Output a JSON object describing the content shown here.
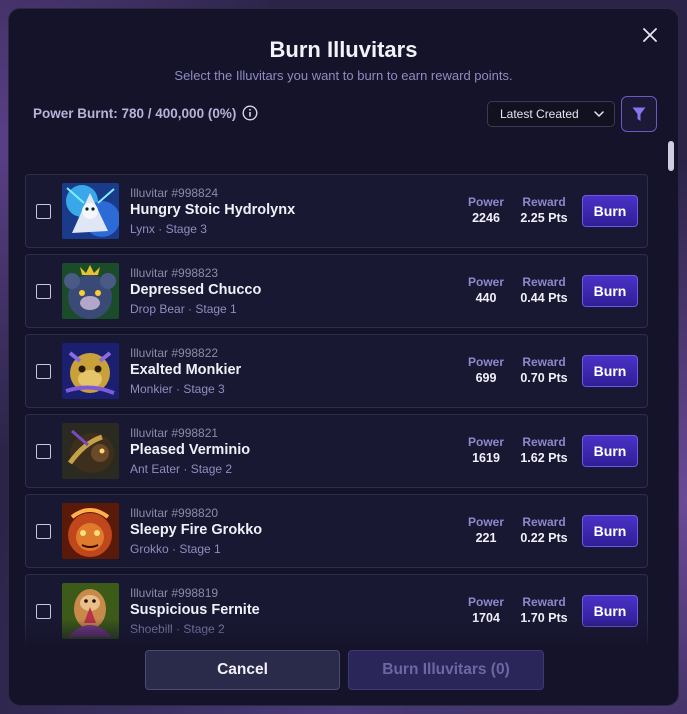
{
  "modal": {
    "title": "Burn Illuvitars",
    "subtitle": "Select the Illuvitars you want to burn to earn reward points.",
    "power_burnt": "Power Burnt: 780 / 400,000 (0%)",
    "sort": {
      "selected": "Latest Created"
    },
    "power_label": "Power",
    "reward_label": "Reward",
    "burn_label": "Burn",
    "cancel_label": "Cancel",
    "burn_all_label": "Burn Illuvitars (0)",
    "accent_color": "#3a26b0"
  },
  "items": [
    {
      "id": "Illuvitar #998824",
      "name": "Hungry Stoic Hydrolynx",
      "meta": "Lynx · Stage 3",
      "power": "2246",
      "reward": "2.25 Pts",
      "image": "blue-lynx-creature"
    },
    {
      "id": "Illuvitar #998823",
      "name": "Depressed Chucco",
      "meta": "Drop Bear · Stage 1",
      "power": "440",
      "reward": "0.44 Pts",
      "image": "green-drop-bear"
    },
    {
      "id": "Illuvitar #998822",
      "name": "Exalted Monkier",
      "meta": "Monkier · Stage 3",
      "power": "699",
      "reward": "0.70 Pts",
      "image": "golden-monkey"
    },
    {
      "id": "Illuvitar #998821",
      "name": "Pleased Verminio",
      "meta": "Ant Eater · Stage 2",
      "power": "1619",
      "reward": "1.62 Pts",
      "image": "dark-ant-eater"
    },
    {
      "id": "Illuvitar #998820",
      "name": "Sleepy Fire Grokko",
      "meta": "Grokko · Stage 1",
      "power": "221",
      "reward": "0.22 Pts",
      "image": "fire-grokko"
    },
    {
      "id": "Illuvitar #998819",
      "name": "Suspicious Fernite",
      "meta": "Shoebill · Stage 2",
      "power": "1704",
      "reward": "1.70 Pts",
      "image": "green-shoebill"
    }
  ]
}
